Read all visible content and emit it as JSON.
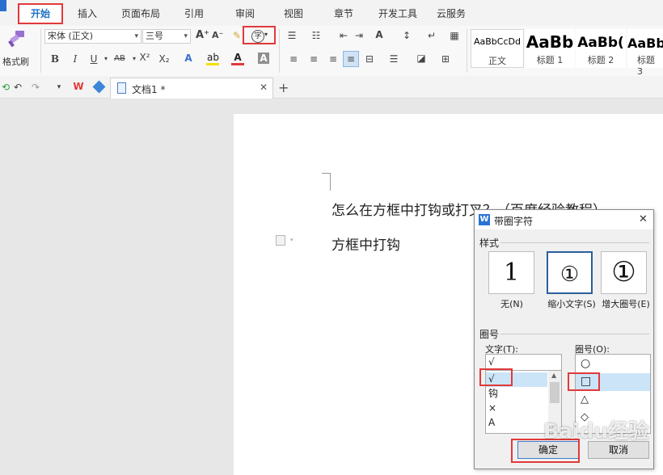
{
  "ribbon_tabs": [
    "开始",
    "插入",
    "页面布局",
    "引用",
    "审阅",
    "视图",
    "章节",
    "开发工具",
    "云服务"
  ],
  "ribbon": {
    "format_painter": "格式刷",
    "font_name": "宋体 (正文)",
    "font_size": "三号",
    "styles": [
      {
        "sample": "AaBbCcDd",
        "name": "正文"
      },
      {
        "sample": "AaBb",
        "name": "标题 1"
      },
      {
        "sample": "AaBb(",
        "name": "标题 2"
      },
      {
        "sample": "AaBb",
        "name": "标题 3"
      }
    ],
    "enclose_char_icon": "字"
  },
  "doc_tab": {
    "title": "文档1 *"
  },
  "document": {
    "line1": "怎么在方框中打钩或打叉？（百度经验教程）",
    "line2": "方框中打钩"
  },
  "dialog": {
    "title": "带圈字符",
    "style_section": "样式",
    "style_options": [
      {
        "glyph": "1",
        "label": "无(N)"
      },
      {
        "glyph": "①",
        "label": "缩小文字(S)"
      },
      {
        "glyph": "①",
        "label": "增大圈号(E)"
      }
    ],
    "enclosure_section": "圈号",
    "text_label": "文字(T):",
    "text_input_value": "√",
    "text_list": [
      "√",
      "钩",
      "×",
      "A"
    ],
    "text_list_selected": "√",
    "enclosure_label": "圈号(O):",
    "enclosure_list": [
      "○",
      "□",
      "△",
      "◇"
    ],
    "enclosure_selected": "□",
    "ok": "确定",
    "cancel": "取消"
  },
  "watermark": "Baidu经验",
  "colors": {
    "accent_blue": "#1e72c8",
    "highlight_red": "#e2393a",
    "selection": "#cce4f7"
  }
}
